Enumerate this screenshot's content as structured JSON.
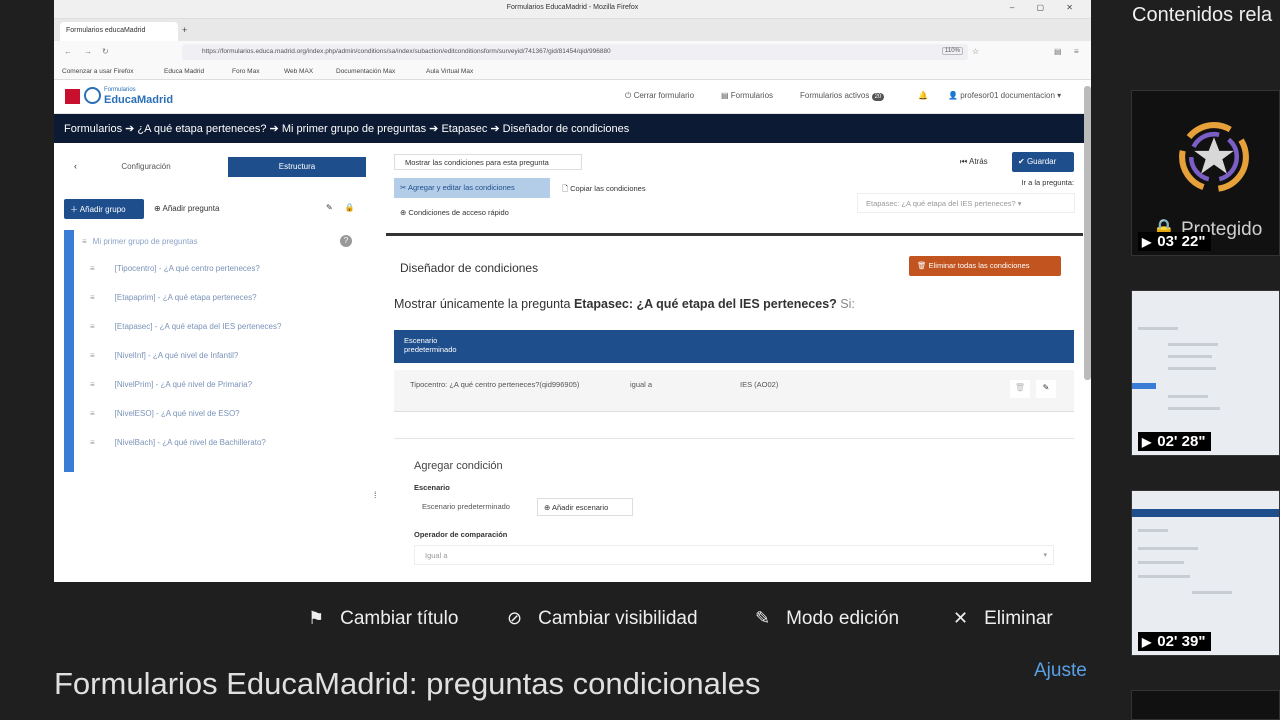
{
  "browser": {
    "window_title": "Formularios EducaMadrid - Mozilla Firefox",
    "tab_label": "Formularios educaMadrid",
    "url": "https://formularios.educa.madrid.org/index.php/admin/conditions/sa/index/subaction/editconditionsform/surveyid/741367/gid/81454/qid/996880",
    "zoom": "110%",
    "bookmarks": [
      "Comenzar a usar Firefox",
      "Educa Madrid",
      "Foro Max",
      "Web MAX",
      "Documentación Max",
      "Aula Virtual Max"
    ]
  },
  "site": {
    "logo_sub": "Formularios",
    "logo_main": "EducaMadrid",
    "close_form": "Cerrar formulario",
    "forms": "Formularios",
    "active_forms": "Formularios activos",
    "active_count": "20",
    "user": "profesor01 documentacion"
  },
  "breadcrumb": {
    "items": [
      "Formularios",
      "¿A qué etapa perteneces?",
      "Mi primer grupo de preguntas",
      "Etapasec",
      "Diseñador de condiciones"
    ]
  },
  "left": {
    "tab_config": "Configuración",
    "tab_structure": "Estructura",
    "add_group": "Añadir grupo",
    "add_question": "Añadir pregunta",
    "group_name": "Mi primer grupo de preguntas",
    "questions": [
      "[Tipocentro] - ¿A qué centro perteneces?",
      "[Etapaprim] - ¿A qué etapa perteneces?",
      "[Etapasec] - ¿A qué etapa del IES perteneces?",
      "[NivelInf] - ¿A qué nivel de Infantil?",
      "[NivelPrim] - ¿A qué nivel de Primaria?",
      "[NivelESO] - ¿A qué nivel de ESO?",
      "[NivelBach] - ¿A qué nivel de Bachillerato?"
    ]
  },
  "main": {
    "show_conditions": "Mostrar las condiciones para esta pregunta",
    "back": "Atrás",
    "save": "Guardar",
    "goto_label": "Ir a la pregunta:",
    "edit_conditions": "Agregar y editar las condiciones",
    "copy_conditions": "Copiar las condiciones",
    "goto_value": "Etapasec: ¿A qué etapa del IES perteneces?",
    "quick_conditions": "Condiciones de acceso rápido",
    "designer_title": "Diseñador de condiciones",
    "delete_all": "Eliminar todas las condiciones",
    "show_only_prefix": "Mostrar únicamente la pregunta",
    "show_only_question": "Etapasec: ¿A qué etapa del IES perteneces?",
    "show_only_suffix": "Si:",
    "scenario_line1": "Escenario",
    "scenario_line2": "predeterminado",
    "condition_question": "Tipocentro: ¿A qué centro perteneces?(qid996905)",
    "condition_operator": "igual a",
    "condition_value": "IES (AO02)",
    "add_condition": "Agregar condición",
    "scenario_label": "Escenario",
    "scenario_default": "Escenario predeterminado",
    "add_scenario": "Añadir escenario",
    "operator_label": "Operador de comparación",
    "operator_value": "Igual a"
  },
  "player": {
    "change_title": "Cambiar título",
    "change_visibility": "Cambiar visibilidad",
    "edit_mode": "Modo edición",
    "delete": "Eliminar",
    "video_title": "Formularios EducaMadrid: preguntas condicionales",
    "settings": "Ajuste"
  },
  "related": {
    "heading": "Contenidos rela",
    "protected": "Protegido",
    "durations": [
      "03' 22\"",
      "02' 28\"",
      "02' 39\""
    ]
  },
  "colors": {
    "brand_blue": "#1f4e8c",
    "breadcrumb_bg": "#0c1a33",
    "danger": "#c1541f",
    "link_blue": "#5aa0e6"
  }
}
